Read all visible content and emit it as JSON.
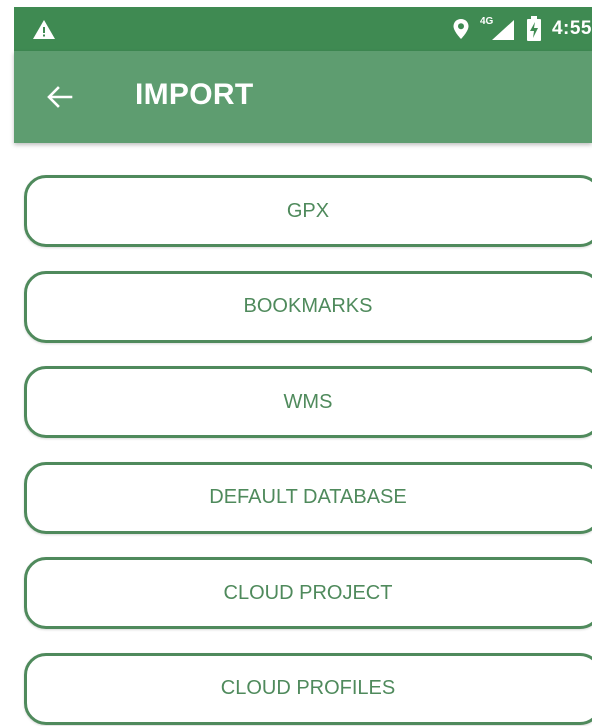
{
  "status_bar": {
    "time": "4:55",
    "network": "4G",
    "icons": [
      "warning-icon",
      "location-icon",
      "signal-icon",
      "battery-charging-icon"
    ]
  },
  "app_bar": {
    "title": "IMPORT",
    "back_icon": "arrow-back-icon"
  },
  "menu": {
    "items": [
      {
        "label": "GPX"
      },
      {
        "label": "BOOKMARKS"
      },
      {
        "label": "WMS"
      },
      {
        "label": "DEFAULT DATABASE"
      },
      {
        "label": "CLOUD PROJECT"
      },
      {
        "label": "CLOUD PROFILES"
      }
    ]
  },
  "colors": {
    "status_bar": "#3f8a52",
    "app_bar": "#5e9d70",
    "accent": "#4f8a5c",
    "background": "#ffffff"
  }
}
